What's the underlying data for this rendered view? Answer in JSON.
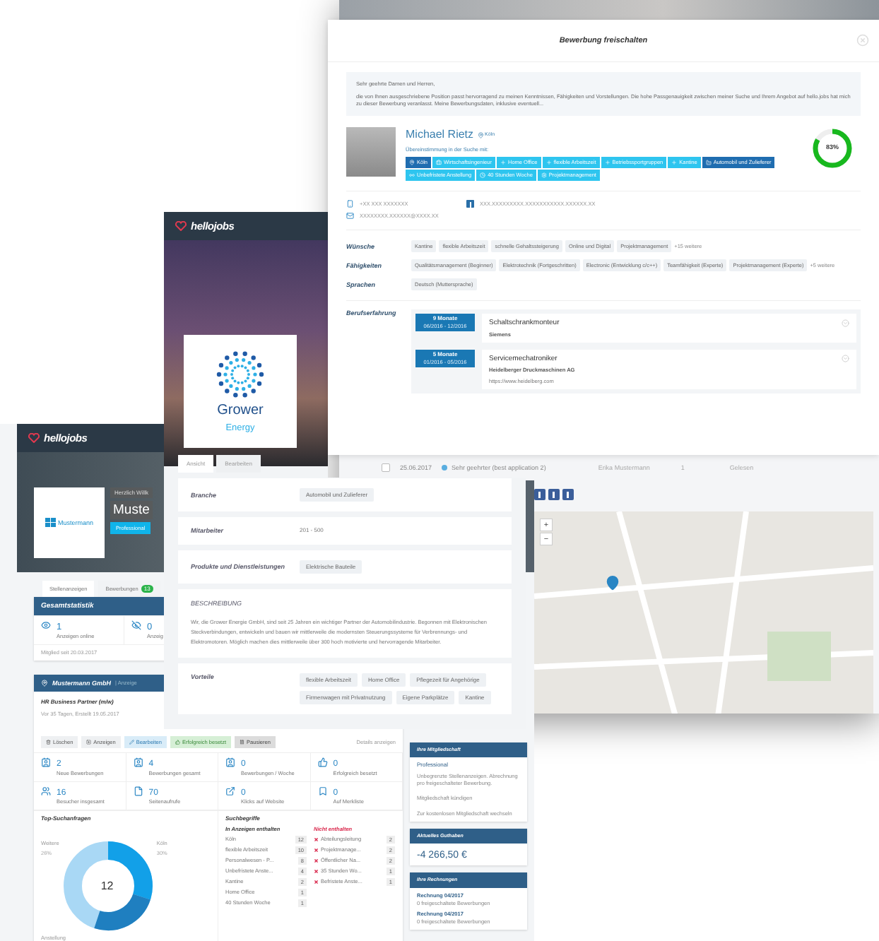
{
  "background_page": {
    "list_row": {
      "checked": false,
      "date": "25.06.2017",
      "subject": "Sehr geehrter (best application 2)",
      "sender": "Erika Mustermann",
      "count": "1",
      "status": "Gelesen"
    },
    "map_controls": [
      "+",
      "−"
    ]
  },
  "modal": {
    "title": "Bewerbung freischalten",
    "message": {
      "greeting": "Sehr geehrte Damen und Herren,",
      "body": "die von Ihnen ausgeschriebene Position passt hervorragend zu meinen Kenntnissen, Fähigkeiten und Vorstellungen. Die hohe Passgenauigkeit zwischen meiner Suche und Ihrem Angebot auf hello.jobs hat mich zu dieser Bewerbung veranlasst. Meine Bewerbungsdaten, inklusive eventuell..."
    },
    "candidate": {
      "name": "Michael Rietz",
      "location": "Köln",
      "match_label": "Übereinstimmung in der Suche mit:",
      "match_percent": "83%",
      "level": 0.83,
      "match_tags": [
        {
          "label": "Köln",
          "highlighted": true
        },
        {
          "label": "Wirtschaftsingenieur",
          "highlighted": false
        },
        {
          "label": "Home Office",
          "highlighted": false
        },
        {
          "label": "flexible Arbeitszeit",
          "highlighted": false
        },
        {
          "label": "Betriebssportgruppen",
          "highlighted": false
        },
        {
          "label": "Kantine",
          "highlighted": false
        },
        {
          "label": "Automobil und Zulieferer",
          "highlighted": true
        },
        {
          "label": "Unbefristete Anstellung",
          "highlighted": false
        },
        {
          "label": "40 Stunden Woche",
          "highlighted": false
        },
        {
          "label": "Projektmanagement",
          "highlighted": false
        }
      ]
    },
    "contacts": [
      {
        "kind": "phone",
        "value": "+XX XXX XXXXXXX"
      },
      {
        "kind": "facebook",
        "value": "XXX.XXXXXXXXX.XXXXXXXXXXX.XXXXXX.XX"
      },
      {
        "kind": "mail",
        "value": "XXXXXXXX.XXXXXX@XXXX.XX"
      }
    ],
    "sections": [
      {
        "label": "Wünsche",
        "chips": [
          "Kantine",
          "flexible Arbeitszeit",
          "schnelle Gehaltssteigerung",
          "Online und Digital",
          "Projektmanagement"
        ],
        "more": "+15 weitere"
      },
      {
        "label": "Fähigkeiten",
        "chips": [
          "Qualitätsmanagement (Beginner)",
          "Elektrotechnik (Fortgeschritten)",
          "Electronic (Entwicklung c/c++)",
          "Teamfähigkeit (Experte)",
          "Projektmanagement (Experte)"
        ],
        "more": "+5 weitere"
      },
      {
        "label": "Sprachen",
        "chips": [
          "Deutsch (Muttersprache)"
        ]
      }
    ],
    "experience": {
      "label": "Berufserfahrung",
      "entries": [
        {
          "duration": "9 Monate",
          "dates": "06/2016 - 12/2016",
          "title": "Schaltschrankmonteur",
          "company": "Siemens"
        },
        {
          "duration": "5 Monate",
          "dates": "01/2016 - 05/2016",
          "title": "Servicemechatroniker",
          "company": "Heidelberger Druckmaschinen AG",
          "url": "https://www.heidelberg.com"
        }
      ]
    }
  },
  "company_page": {
    "logo": "hellojobs",
    "company_logo": {
      "line1": "Grower",
      "line2": "Energy"
    },
    "tabs": [
      {
        "label": "Ansicht",
        "selected": true
      },
      {
        "label": "Bearbeiten",
        "selected": false
      }
    ],
    "rows": [
      {
        "label": "Branche",
        "chips": [
          "Automobil und Zulieferer"
        ]
      },
      {
        "label": "Mitarbeiter",
        "value": "201 - 500"
      },
      {
        "label": "Produkte und Dienstleistungen",
        "chips": [
          "Elektrische Bauteile"
        ]
      }
    ],
    "description": {
      "heading": "BESCHREIBUNG",
      "text": "Wir, die Grower Energie GmbH, sind seit 25 Jahren ein wichtiger Partner der Automobilindustrie. Begonnen mit Elektronischen Steckverbindungen, entwickeln und bauen wir mittlerweile die modernsten Steuerungssysteme für Verbrennungs- und Elektromotoren. Möglich machen dies mittlerweile über 300 hoch motivierte und hervorragende Mitarbeiter."
    },
    "benefits": {
      "label": "Vorteile",
      "chips": [
        "flexible Arbeitszeit",
        "Home Office",
        "Pflegezeit für Angehörige",
        "Firmenwagen mit Privatnutzung",
        "Eigene Parkplätze",
        "Kantine"
      ]
    }
  },
  "dashboard": {
    "logo": "hellojobs",
    "company_logo": "Mustermann",
    "greeting": "Herzlich Willk",
    "company_name": "Muste",
    "plan_badge": "Professional",
    "tabs": [
      {
        "label": "Stellenanzeigen",
        "selected": true
      },
      {
        "label": "Bewerbungen",
        "selected": false,
        "badge": "13"
      }
    ],
    "overview": {
      "title": "Gesamtstatistik",
      "stats": [
        {
          "value": "1",
          "label": "Anzeigen online"
        },
        {
          "value": "0",
          "label": "Anzeig"
        }
      ],
      "member_since": "Mitglied seit 20.03.2017"
    },
    "job": {
      "company": "Mustermann GmbH",
      "tag": "| Anzeige",
      "title": "HR Business Partner (m/w)",
      "meta": "Vor 35 Tagen, Erstellt 19.05.2017",
      "actions": [
        {
          "label": "Löschen",
          "kind": "plain"
        },
        {
          "label": "Anzeigen",
          "kind": "plain"
        },
        {
          "label": "Bearbeiten",
          "kind": "info"
        },
        {
          "label": "Erfolgreich besetzt",
          "kind": "success"
        },
        {
          "label": "Pausieren",
          "kind": "dark"
        }
      ],
      "details": "Details anzeigen",
      "stats": [
        {
          "value": "2",
          "label": "Neue Bewerbungen"
        },
        {
          "value": "4",
          "label": "Bewerbungen gesamt"
        },
        {
          "value": "0",
          "label": "Bewerbungen / Woche"
        },
        {
          "value": "0",
          "label": "Erfolgreich besetzt"
        },
        {
          "value": "16",
          "label": "Besucher insgesamt"
        },
        {
          "value": "70",
          "label": "Seitenaufrufe"
        },
        {
          "value": "0",
          "label": "Klicks auf Website"
        },
        {
          "value": "0",
          "label": "Auf Merkliste"
        }
      ],
      "top_searches": {
        "title": "Top-Suchanfragen",
        "center": "12",
        "labels": [
          {
            "name": "Weitere",
            "share": "26%"
          },
          {
            "name": "Köln",
            "share": "30%"
          },
          {
            "name": "Anstellung"
          }
        ]
      },
      "terms": {
        "title": "Suchbegriffe",
        "included_title": "In Anzeigen enthalten",
        "excluded_title": "Nicht enthalten",
        "included": [
          {
            "label": "Köln",
            "count": "12"
          },
          {
            "label": "flexible Arbeitszeit",
            "count": "10"
          },
          {
            "label": "Personalwesen - P...",
            "count": "8"
          },
          {
            "label": "Unbefristete Anste...",
            "count": "4"
          },
          {
            "label": "Kantine",
            "count": "2"
          },
          {
            "label": "Home Office",
            "count": "1"
          },
          {
            "label": "40 Stunden Woche",
            "count": "1"
          }
        ],
        "excluded": [
          {
            "label": "Abteilungsleitung",
            "count": "2"
          },
          {
            "label": "Projektmanage...",
            "count": "2"
          },
          {
            "label": "Öffentlicher Na...",
            "count": "2"
          },
          {
            "label": "35 Stunden Wo...",
            "count": "1"
          },
          {
            "label": "Befristete Anste...",
            "count": "1"
          }
        ]
      }
    },
    "membership": {
      "title": "Ihre Mitgliedschaft",
      "plan": "Professional",
      "description": "Unbegrenzte Stellenanzeigen. Abrechnung pro freigeschalteter Bewerbung.",
      "links": [
        "Mitgliedschaft kündigen",
        "Zur kostenlosen Mitgliedschaft wechseln"
      ]
    },
    "balance": {
      "title": "Aktuelles Guthaben",
      "amount": "-4 266,50 €"
    },
    "invoices": {
      "title": "Ihre Rechnungen",
      "items": [
        {
          "title": "Rechnung 04/2017",
          "note": "0 freigeschaltete Bewerbungen"
        },
        {
          "title": "Rechnung 04/2017",
          "note": "0 freigeschaltete Bewerbungen"
        }
      ]
    }
  }
}
